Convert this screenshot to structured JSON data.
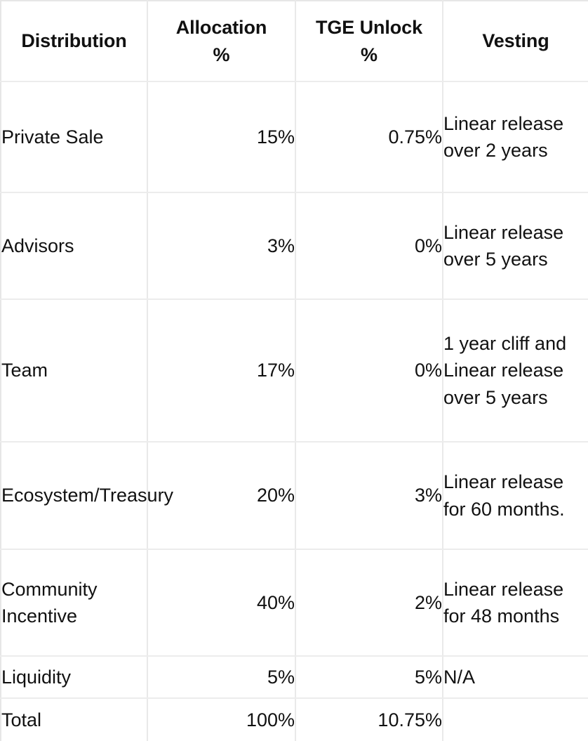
{
  "table": {
    "name": "token-distribution-table",
    "columns": [
      {
        "key": "distribution",
        "label": "Distribution",
        "align": "left"
      },
      {
        "key": "allocation",
        "label": "Allocation %",
        "align": "right"
      },
      {
        "key": "tge_unlock",
        "label": "TGE Unlock %",
        "align": "right"
      },
      {
        "key": "vesting",
        "label": "Vesting",
        "align": "left"
      }
    ],
    "header": {
      "distribution": "Distribution",
      "allocation_line1": "Allocation",
      "allocation_line2": "%",
      "tge_line1": "TGE Unlock",
      "tge_line2": "%",
      "vesting": "Vesting"
    },
    "rows": [
      {
        "distribution": "Private Sale",
        "allocation": "15%",
        "tge_unlock": "0.75%",
        "vesting": "Linear release over 2 years"
      },
      {
        "distribution": "Advisors",
        "allocation": "3%",
        "tge_unlock": "0%",
        "vesting": "Linear release over 5 years"
      },
      {
        "distribution": "Team",
        "allocation": "17%",
        "tge_unlock": "0%",
        "vesting": "1 year cliff and Linear release over 5 years"
      },
      {
        "distribution": "Ecosystem/Treasury",
        "allocation": "20%",
        "tge_unlock": "3%",
        "vesting": "Linear release for 60 months."
      },
      {
        "distribution": "Community Incentive",
        "allocation": "40%",
        "tge_unlock": "2%",
        "vesting": "Linear release for 48 months"
      },
      {
        "distribution": "Liquidity",
        "allocation": "5%",
        "tge_unlock": "5%",
        "vesting": "N/A"
      },
      {
        "distribution": "Total",
        "allocation": "100%",
        "tge_unlock": "10.75%",
        "vesting": ""
      }
    ]
  },
  "colors": {
    "text": "#111111",
    "grid": "#ececec",
    "background": "#ffffff"
  }
}
